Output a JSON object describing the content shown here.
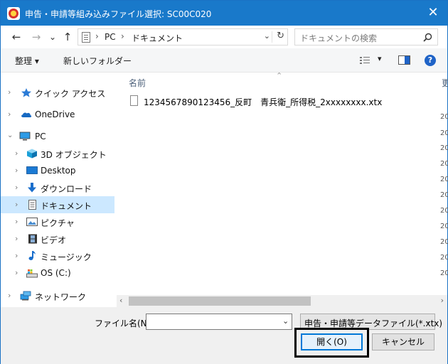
{
  "window": {
    "title": "申告・申請等組み込みファイル選択: SC00C020"
  },
  "nav": {
    "back": "←",
    "forward": "→",
    "recent": "⌄",
    "up": "↑"
  },
  "address": {
    "root": "PC",
    "folder": "ドキュメント"
  },
  "search": {
    "placeholder": "ドキュメントの検索"
  },
  "toolbar": {
    "organize": "整理 ▾",
    "new_folder": "新しいフォルダー"
  },
  "sidebar": {
    "items": [
      {
        "label": "クイック アクセス"
      },
      {
        "label": "OneDrive"
      },
      {
        "label": "PC"
      },
      {
        "label": "3D オブジェクト"
      },
      {
        "label": "Desktop"
      },
      {
        "label": "ダウンロード"
      },
      {
        "label": "ドキュメント"
      },
      {
        "label": "ピクチャ"
      },
      {
        "label": "ビデオ"
      },
      {
        "label": "ミュージック"
      },
      {
        "label": "OS (C:)"
      },
      {
        "label": "ネットワーク"
      }
    ]
  },
  "content": {
    "column_name": "名前",
    "column_edge": "更",
    "date_fragments": [
      "20",
      "20",
      "20",
      "20",
      "20",
      "20",
      "20",
      "20",
      "20",
      "20",
      "20"
    ],
    "files": [
      {
        "name": "1234567890123456_反町　青兵衛_所得税_2xxxxxxxx.xtx"
      }
    ]
  },
  "footer": {
    "filename_label": "ファイル名(N):",
    "filename_value": "",
    "filetype": "申告・申請等データファイル(*.xtx)",
    "open_label": "開く(O)",
    "cancel_label": "キャンセル"
  },
  "colors": {
    "titlebar": "#1979ca",
    "selection": "#cce8ff",
    "primary_border": "#0078d7"
  }
}
